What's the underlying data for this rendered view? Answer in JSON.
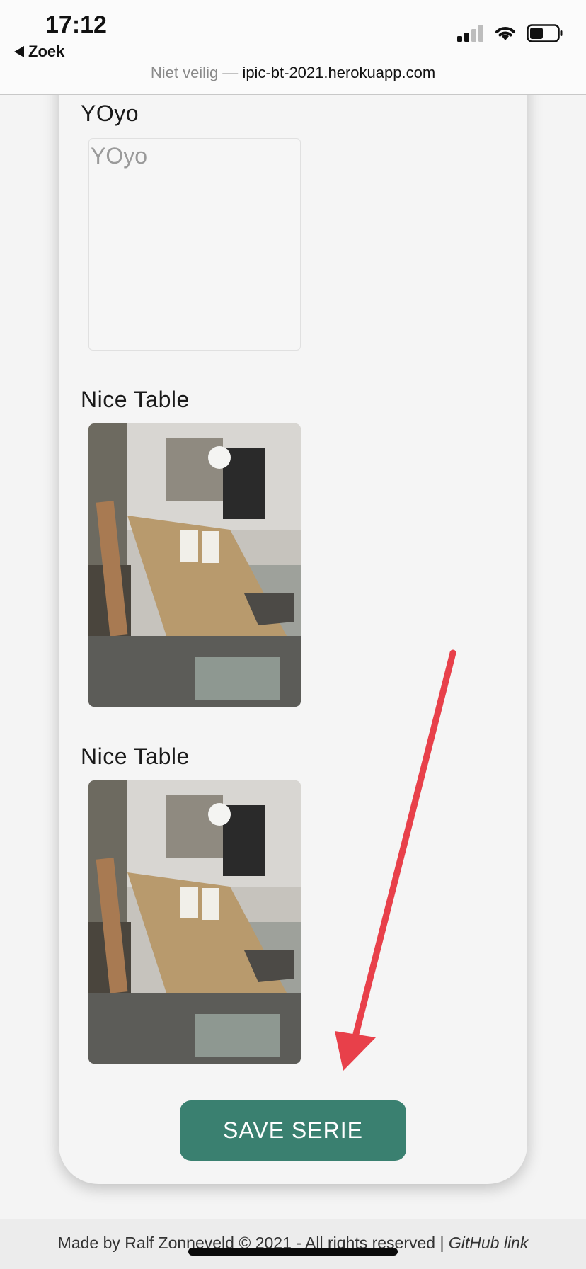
{
  "status_bar": {
    "time": "17:12",
    "back_label": "Zoek"
  },
  "browser": {
    "insecure_label": "Niet veilig —",
    "host": "ipic-bt-2021.herokuapp.com"
  },
  "items": [
    {
      "title": "YOyo",
      "image_alt": "YOyo"
    },
    {
      "title": "Nice Table"
    },
    {
      "title": "Nice Table"
    }
  ],
  "save_button_label": "SAVE SERIE",
  "footer": {
    "text": "Made by Ralf Zonneveld © 2021 - All rights reserved |",
    "link_label": "GitHub link"
  },
  "colors": {
    "accent": "#3a8070",
    "annotation_arrow": "#e8404a"
  }
}
